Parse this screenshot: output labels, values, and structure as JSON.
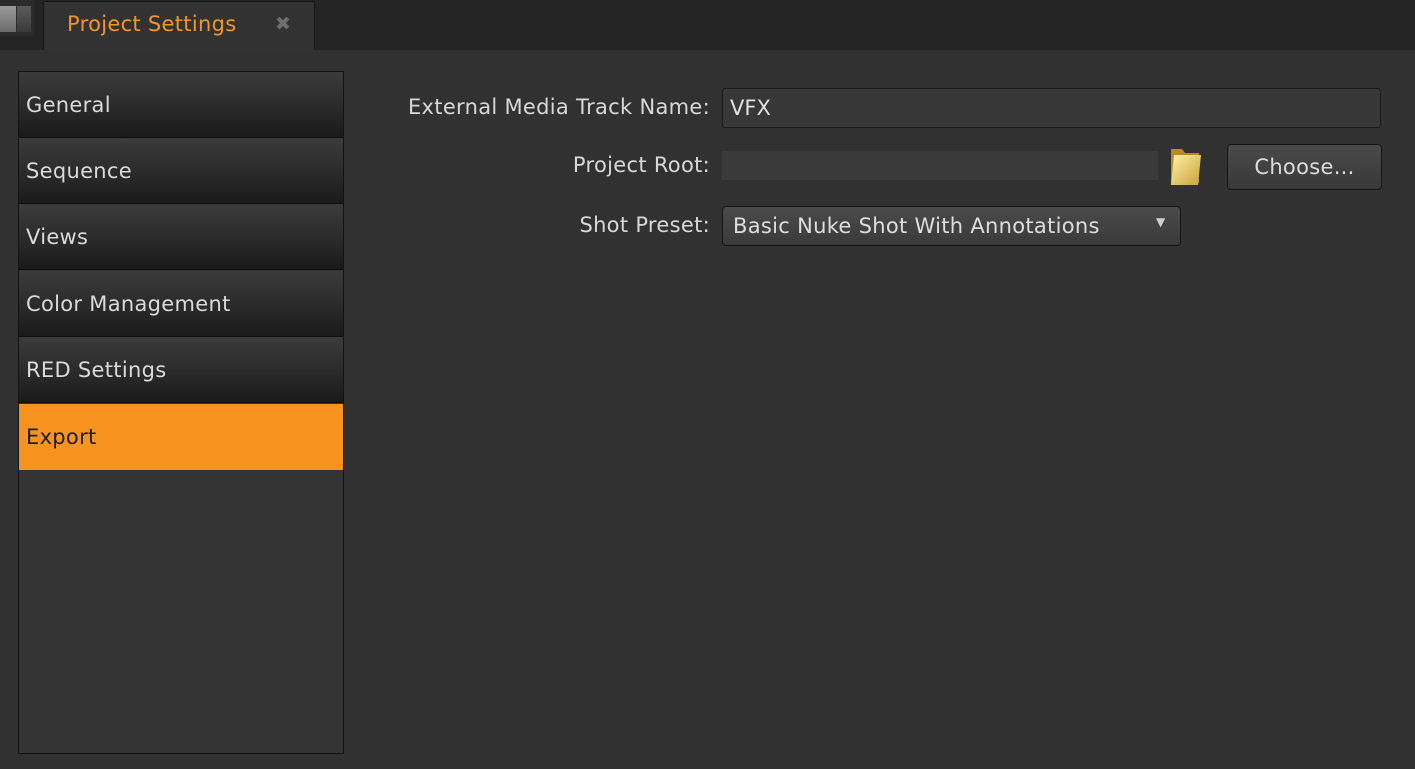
{
  "tab": {
    "title": "Project Settings",
    "close_glyph": "✖"
  },
  "sidebar": {
    "items": [
      {
        "label": "General",
        "active": false
      },
      {
        "label": "Sequence",
        "active": false
      },
      {
        "label": "Views",
        "active": false
      },
      {
        "label": "Color Management",
        "active": false
      },
      {
        "label": "RED Settings",
        "active": false
      },
      {
        "label": "Export",
        "active": true
      }
    ]
  },
  "form": {
    "track_name_label": "External Media Track Name:",
    "track_name_value": "VFX",
    "project_root_label": "Project Root:",
    "project_root_value": "",
    "choose_button_label": "Choose...",
    "shot_preset_label": "Shot Preset:",
    "shot_preset_value": "Basic Nuke Shot With Annotations",
    "dropdown_arrow_glyph": "▼"
  },
  "colors": {
    "accent": "#f7931e",
    "tab_title": "#f2952b",
    "background": "#313131"
  },
  "icons": {
    "folder": "folder-icon",
    "close": "close-icon",
    "dropdown": "chevron-down-icon"
  }
}
